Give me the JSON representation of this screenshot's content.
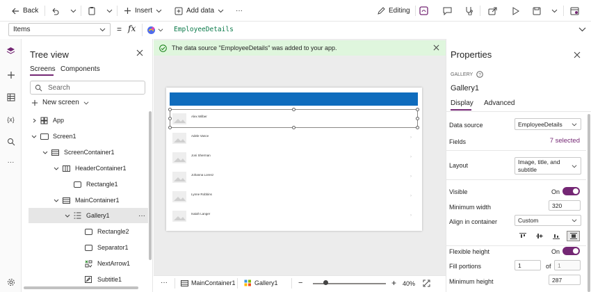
{
  "toolbar": {
    "back": "Back",
    "insert": "Insert",
    "add_data": "Add data",
    "more": "···",
    "editing": "Editing"
  },
  "formula": {
    "property": "Items",
    "fx": "fx",
    "eq": "=",
    "value": "EmployeeDetails"
  },
  "notification": {
    "message": "The data source \"EmployeeDetails\" was added to your app."
  },
  "tree": {
    "title": "Tree view",
    "tab_screens": "Screens",
    "tab_components": "Components",
    "search_placeholder": "Search",
    "new_screen": "New screen",
    "nodes": [
      "App",
      "Screen1",
      "ScreenContainer1",
      "HeaderContainer1",
      "Rectangle1",
      "MainContainer1",
      "Gallery1",
      "Rectangle2",
      "Separator1",
      "NextArrow1",
      "Subtitle1"
    ],
    "more": "···"
  },
  "gallery": {
    "items": [
      "Alex Wilber",
      "Adele Vance",
      "Joni Sherman",
      "Johanna Lorenz",
      "Lynne Robbins",
      "Isaiah Langer"
    ]
  },
  "status": {
    "more": "···",
    "crumb1": "MainContainer1",
    "crumb2": "Gallery1",
    "zoom": "40%"
  },
  "props": {
    "title": "Properties",
    "kind": "GALLERY",
    "name": "Gallery1",
    "tab_display": "Display",
    "tab_advanced": "Advanced",
    "data_source_label": "Data source",
    "data_source_value": "EmployeeDetails",
    "fields_label": "Fields",
    "fields_value": "7 selected",
    "layout_label": "Layout",
    "layout_value": "Image, title, and subtitle",
    "visible_label": "Visible",
    "visible_value": "On",
    "min_width_label": "Minimum width",
    "min_width_value": "320",
    "align_label": "Align in container",
    "align_value": "Custom",
    "flex_label": "Flexible height",
    "flex_value": "On",
    "fill_label": "Fill portions",
    "fill_value": "1",
    "fill_of": "of",
    "fill_total": "1",
    "min_height_label": "Minimum height",
    "min_height_value": "287"
  },
  "colors": {
    "accent": "#742774",
    "header_bar": "#0f6cbd",
    "notice_bg": "#dff6dd",
    "notice_icon": "#107c10"
  }
}
